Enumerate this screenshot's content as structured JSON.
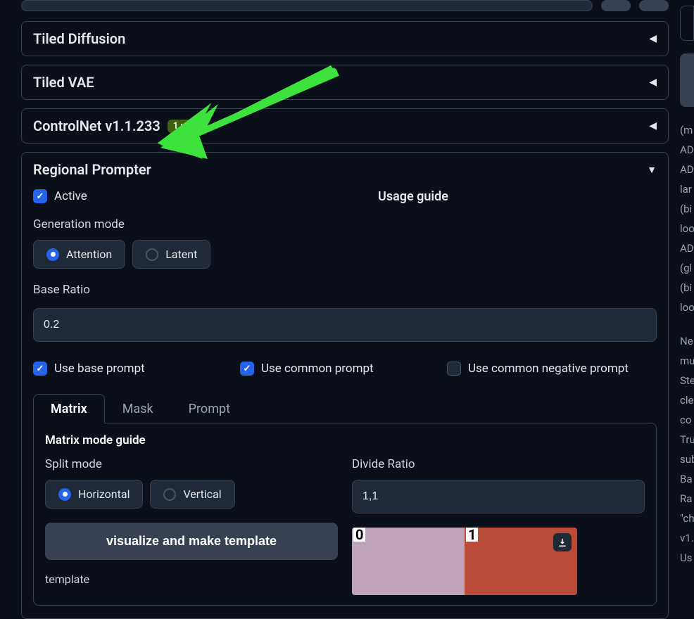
{
  "accordions": {
    "tiled_diffusion": "Tiled Diffusion",
    "tiled_vae": "Tiled VAE",
    "controlnet": "ControlNet v1.1.233",
    "controlnet_badge": "1 un",
    "regional_prompter": "Regional Prompter"
  },
  "rp": {
    "active_label": "Active",
    "usage_guide": "Usage guide",
    "gen_mode_label": "Generation mode",
    "gen_mode_attention": "Attention",
    "gen_mode_latent": "Latent",
    "base_ratio_label": "Base Ratio",
    "base_ratio_value": "0.2",
    "use_base_prompt": "Use base prompt",
    "use_common_prompt": "Use common prompt",
    "use_common_negative": "Use common negative prompt",
    "tabs": {
      "matrix": "Matrix",
      "mask": "Mask",
      "prompt": "Prompt"
    },
    "matrix": {
      "guide": "Matrix mode guide",
      "split_mode_label": "Split mode",
      "horizontal": "Horizontal",
      "vertical": "Vertical",
      "divide_ratio_label": "Divide Ratio",
      "divide_ratio_value": "1,1",
      "visualize_btn": "visualize and make template",
      "template_label": "template",
      "region0": "0",
      "region1": "1"
    }
  },
  "sidebar_lines": [
    "(m",
    "AD",
    "AD",
    "lar",
    "(bi",
    "loo",
    "AD",
    "(gl",
    "(bi",
    "loo",
    "",
    "Ne",
    "mu",
    "Ste",
    "cle",
    "co",
    "Tru",
    "sub",
    "Ba",
    "Ra",
    "\"ch",
    "v1.",
    "Us"
  ]
}
